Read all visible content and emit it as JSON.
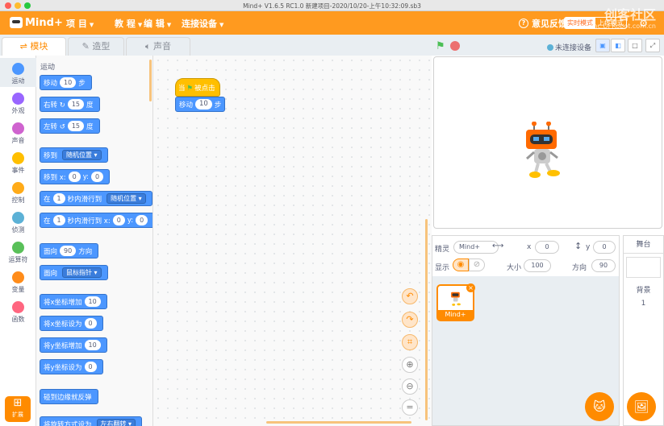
{
  "window": {
    "title": "Mind+ V1.6.5 RC1.0   新建项目-2020/10/20-上午10:32:09.sb3"
  },
  "menu": {
    "logo": "Mind+",
    "items": [
      "项 目",
      "教 程",
      "编 辑",
      "连接设备"
    ],
    "help": "意见反馈",
    "mode_on": "实时模式",
    "mode_off": "上传模式"
  },
  "watermark": {
    "main": "创客社区",
    "sub": "mc.DFRobot.com.cn"
  },
  "tabs": [
    "模块",
    "造型",
    "声音"
  ],
  "categories": [
    {
      "label": "运动",
      "color": "#4c97ff"
    },
    {
      "label": "外观",
      "color": "#9966ff"
    },
    {
      "label": "声音",
      "color": "#cf63cf"
    },
    {
      "label": "事件",
      "color": "#ffbf00"
    },
    {
      "label": "控制",
      "color": "#ffab19"
    },
    {
      "label": "侦测",
      "color": "#5cb1d6"
    },
    {
      "label": "运算符",
      "color": "#59c059"
    },
    {
      "label": "变量",
      "color": "#ff8c1a"
    },
    {
      "label": "函数",
      "color": "#ff6680"
    }
  ],
  "extensions_label": "扩展",
  "palette": {
    "title": "运动",
    "blocks": [
      [
        {
          "t": "移动"
        },
        {
          "o": "10"
        },
        {
          "t": "步"
        }
      ],
      [
        {
          "t": "右转 ↻"
        },
        {
          "o": "15"
        },
        {
          "t": "度"
        }
      ],
      [
        {
          "t": "左转 ↺"
        },
        {
          "o": "15"
        },
        {
          "t": "度"
        }
      ],
      [
        {
          "t": "移到"
        },
        {
          "d": "随机位置 ▾"
        }
      ],
      [
        {
          "t": "移到 x:"
        },
        {
          "o": "0"
        },
        {
          "t": "y:"
        },
        {
          "o": "0"
        }
      ],
      [
        {
          "t": "在"
        },
        {
          "o": "1"
        },
        {
          "t": "秒内滑行到"
        },
        {
          "d": "随机位置 ▾"
        }
      ],
      [
        {
          "t": "在"
        },
        {
          "o": "1"
        },
        {
          "t": "秒内滑行到 x:"
        },
        {
          "o": "0"
        },
        {
          "t": "y:"
        },
        {
          "o": "0"
        }
      ],
      [
        {
          "t": "面向"
        },
        {
          "o": "90"
        },
        {
          "t": "方向"
        }
      ],
      [
        {
          "t": "面向"
        },
        {
          "d": "鼠标指针 ▾"
        }
      ],
      [
        {
          "t": "将x坐标增加"
        },
        {
          "o": "10"
        }
      ],
      [
        {
          "t": "将x坐标设为"
        },
        {
          "o": "0"
        }
      ],
      [
        {
          "t": "将y坐标增加"
        },
        {
          "o": "10"
        }
      ],
      [
        {
          "t": "将y坐标设为"
        },
        {
          "o": "0"
        }
      ],
      [
        {
          "t": "碰到边缘就反弹"
        }
      ],
      [
        {
          "t": "将旋转方式设为"
        },
        {
          "d": "左右翻转 ▾"
        }
      ]
    ]
  },
  "script": {
    "hat_pre": "当",
    "hat_post": "被点击",
    "move": "移动",
    "move_value": "10",
    "move_unit": "步"
  },
  "stage": {
    "connection": "未连接设备"
  },
  "sprite": {
    "sprite_label": "精灵",
    "name": "Mind+",
    "x_label": "x",
    "x": "0",
    "y_label": "y",
    "y": "0",
    "show_label": "显示",
    "size_label": "大小",
    "size": "100",
    "direction_label": "方向",
    "direction": "90",
    "thumb_name": "Mind+"
  },
  "stage_panel": {
    "title": "舞台",
    "backdrop_label": "背景",
    "backdrop_count": "1"
  }
}
